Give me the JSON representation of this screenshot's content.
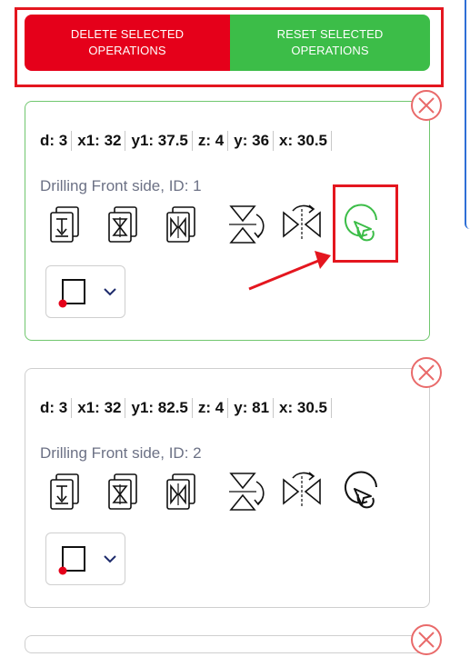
{
  "toolbar": {
    "delete_label": "DELETE SELECTED\nOPERATIONS",
    "reset_label": "RESET SELECTED\nOPERATIONS"
  },
  "colors": {
    "delete": "#e5001a",
    "reset": "#3cbd48",
    "selected_border": "#71c76f",
    "annotation": "#e4161f"
  },
  "operations": [
    {
      "params": [
        {
          "label": "d:",
          "value": "3"
        },
        {
          "label": "x1:",
          "value": "32"
        },
        {
          "label": "y1:",
          "value": "37.5"
        },
        {
          "label": "z:",
          "value": "4"
        },
        {
          "label": "y:",
          "value": "36"
        },
        {
          "label": "x:",
          "value": "30.5"
        }
      ],
      "title": "Drilling Front side, ID: 1",
      "selected": true
    },
    {
      "params": [
        {
          "label": "d:",
          "value": "3"
        },
        {
          "label": "x1:",
          "value": "32"
        },
        {
          "label": "y1:",
          "value": "82.5"
        },
        {
          "label": "z:",
          "value": "4"
        },
        {
          "label": "y:",
          "value": "81"
        },
        {
          "label": "x:",
          "value": "30.5"
        }
      ],
      "title": "Drilling Front side, ID: 2",
      "selected": false
    }
  ],
  "icons": {
    "tools": [
      "drill-sheet-icon",
      "copy-sheet-icon",
      "mirror-sheet-icon",
      "flip-vertical-icon",
      "flip-horizontal-icon",
      "select-pointer-icon"
    ],
    "corner": "corner-origin-icon",
    "dropdown": "chevron-down-icon",
    "close": "close-circle-icon"
  }
}
